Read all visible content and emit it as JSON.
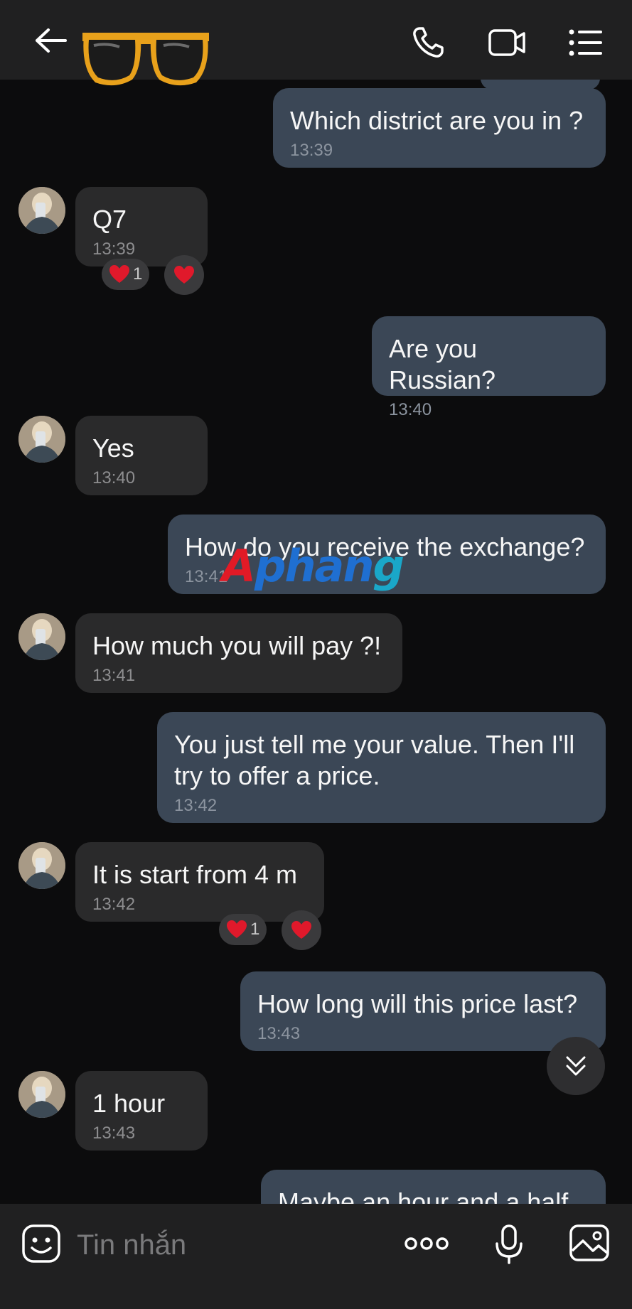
{
  "header": {
    "back_icon": "arrow-left-icon",
    "contact_avatar": "sunglasses-emoji",
    "call_icon": "phone-icon",
    "video_icon": "video-camera-icon",
    "menu_icon": "list-menu-icon"
  },
  "messages": [
    {
      "dir": "out",
      "text": "Which district are you in ?",
      "time": "13:39"
    },
    {
      "dir": "in",
      "text": "Q7",
      "time": "13:39",
      "reaction_count": "1"
    },
    {
      "dir": "out",
      "text": "Are you Russian?",
      "time": "13:40"
    },
    {
      "dir": "in",
      "text": "Yes",
      "time": "13:40"
    },
    {
      "dir": "out",
      "text": "How do you receive the exchange?",
      "time": "13:41"
    },
    {
      "dir": "in",
      "text": "How much you will pay ?!",
      "time": "13:41"
    },
    {
      "dir": "out",
      "text": "You just tell me your value. Then I'll try to offer a price.",
      "time": "13:42"
    },
    {
      "dir": "in",
      "text": "It is start from 4 m",
      "time": "13:42",
      "reaction_count": "1"
    },
    {
      "dir": "out",
      "text": "How long will this price last?",
      "time": "13:43"
    },
    {
      "dir": "in",
      "text": "1 hour",
      "time": "13:43"
    },
    {
      "dir": "out",
      "text": "Maybe an hour and a half ?",
      "time": ""
    }
  ],
  "watermark": {
    "part1": "A",
    "part2": "phan",
    "part3": "g"
  },
  "composer": {
    "placeholder": "Tin nhắn",
    "emoji_icon": "sticker-face-icon",
    "more_icon": "more-dots-icon",
    "mic_icon": "microphone-icon",
    "image_icon": "image-icon"
  },
  "colors": {
    "outgoing": "#3b4756",
    "incoming": "#2a2a2b",
    "background": "#0c0c0d",
    "heart": "#e0192b"
  }
}
